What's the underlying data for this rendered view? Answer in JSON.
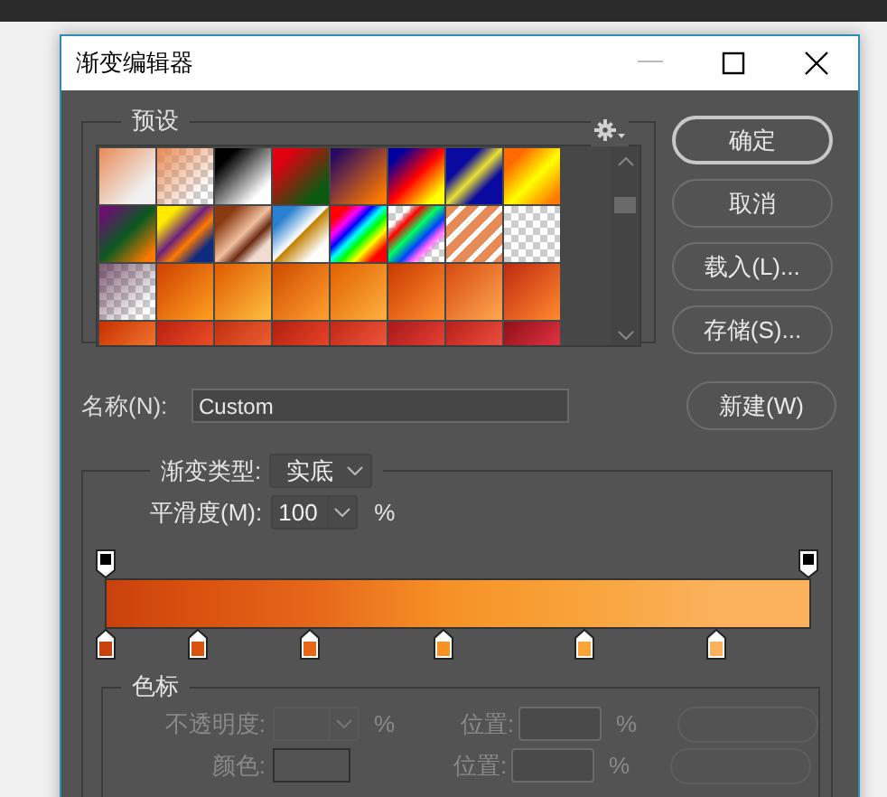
{
  "window": {
    "title": "渐变编辑器"
  },
  "presets": {
    "title": "预设"
  },
  "buttons": [
    {
      "label": "确定",
      "default": true
    },
    {
      "label": "取消",
      "default": false
    },
    {
      "label": "载入(L)...",
      "default": false
    },
    {
      "label": "存储(S)...",
      "default": false
    }
  ],
  "name": {
    "label": "名称(N):",
    "value": "Custom"
  },
  "new_button": {
    "label": "新建(W)"
  },
  "gradient_type": {
    "label": "渐变类型:",
    "value": "实底"
  },
  "smoothness": {
    "label": "平滑度(M):",
    "value": "100",
    "unit": "%"
  },
  "opacity_stops": [
    {
      "level": 0,
      "color": "#000000"
    },
    {
      "level": 1,
      "color": "#000000"
    }
  ],
  "color_stops": [
    {
      "level": 0,
      "color": "#c9410d"
    },
    {
      "level": 0.13,
      "color": "#d9520f"
    },
    {
      "level": 0.29,
      "color": "#e6661a"
    },
    {
      "level": 0.48,
      "color": "#f59125"
    },
    {
      "level": 0.68,
      "color": "#f8a43b"
    },
    {
      "level": 0.87,
      "color": "#fbb15c"
    }
  ],
  "stops_panel": {
    "title": "色标",
    "disabled": true,
    "rows": [
      {
        "label": "不透明度:",
        "kind": "dropdown",
        "unit": "%",
        "location_label": "位置:",
        "location_unit": "%"
      },
      {
        "label": "颜色:",
        "kind": "swatch",
        "location_label": "位置:",
        "location_unit": "%"
      }
    ]
  }
}
